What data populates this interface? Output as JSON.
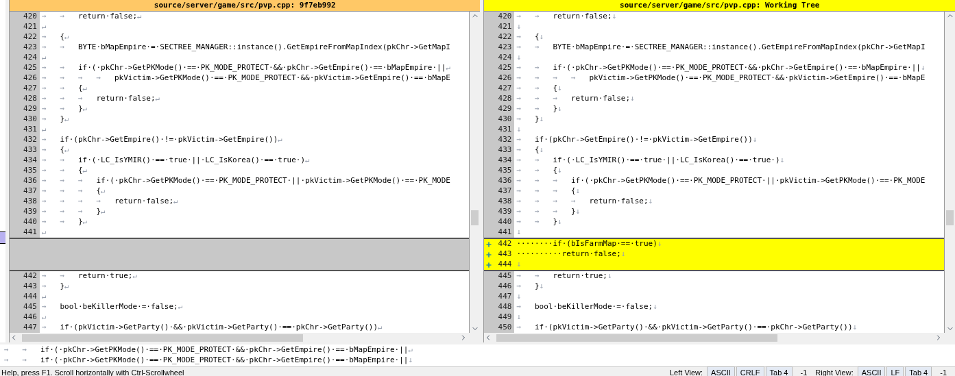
{
  "panes": [
    {
      "title": "source/server/game/src/pvp.cpp: 9f7eb992",
      "color": "#ffc866",
      "eol": "↵",
      "lines": [
        {
          "kind": "normal",
          "num": "420",
          "indent": [
            "→",
            "→"
          ],
          "code": "return·false;",
          "eol": true
        },
        {
          "kind": "normal",
          "num": "421",
          "eol": true
        },
        {
          "kind": "normal",
          "num": "422",
          "indent": [
            "→"
          ],
          "code": "{",
          "eol": true
        },
        {
          "kind": "normal",
          "num": "423",
          "indent": [
            "→",
            "→"
          ],
          "code": "BYTE·bMapEmpire·=·SECTREE_MANAGER::instance().GetEmpireFromMapIndex(pkChr->GetMapI",
          "eol": false
        },
        {
          "kind": "normal",
          "num": "424",
          "eol": true
        },
        {
          "kind": "normal",
          "num": "425",
          "indent": [
            "→",
            "→"
          ],
          "code": "if·(·pkChr->GetPKMode()·==·PK_MODE_PROTECT·&&·pkChr->GetEmpire()·==·bMapEmpire·||",
          "eol": true
        },
        {
          "kind": "normal",
          "num": "426",
          "indent": [
            "→",
            "→",
            "→",
            "→"
          ],
          "code": "pkVictim->GetPKMode()·==·PK_MODE_PROTECT·&&·pkVictim->GetEmpire()·==·bMapE",
          "eol": false
        },
        {
          "kind": "normal",
          "num": "427",
          "indent": [
            "→",
            "→"
          ],
          "code": "{",
          "eol": true
        },
        {
          "kind": "normal",
          "num": "428",
          "indent": [
            "→",
            "→",
            "→"
          ],
          "code": "return·false;",
          "eol": true
        },
        {
          "kind": "normal",
          "num": "429",
          "indent": [
            "→",
            "→"
          ],
          "code": "}",
          "eol": true
        },
        {
          "kind": "normal",
          "num": "430",
          "indent": [
            "→"
          ],
          "code": "}",
          "eol": true
        },
        {
          "kind": "normal",
          "num": "431",
          "eol": true
        },
        {
          "kind": "normal",
          "num": "432",
          "indent": [
            "→"
          ],
          "code": "if·(pkChr->GetEmpire()·!=·pkVictim->GetEmpire())",
          "eol": true
        },
        {
          "kind": "normal",
          "num": "433",
          "indent": [
            "→"
          ],
          "code": "{",
          "eol": true
        },
        {
          "kind": "normal",
          "num": "434",
          "indent": [
            "→",
            "→"
          ],
          "code": "if·(·LC_IsYMIR()·==·true·||·LC_IsKorea()·==·true·)",
          "eol": true
        },
        {
          "kind": "normal",
          "num": "435",
          "indent": [
            "→",
            "→"
          ],
          "code": "{",
          "eol": true
        },
        {
          "kind": "normal",
          "num": "436",
          "indent": [
            "→",
            "→",
            "→"
          ],
          "code": "if·(·pkChr->GetPKMode()·==·PK_MODE_PROTECT·||·pkVictim->GetPKMode()·==·PK_MODE",
          "eol": false
        },
        {
          "kind": "normal",
          "num": "437",
          "indent": [
            "→",
            "→",
            "→"
          ],
          "code": "{",
          "eol": true
        },
        {
          "kind": "normal",
          "num": "438",
          "indent": [
            "→",
            "→",
            "→",
            "→"
          ],
          "code": "return·false;",
          "eol": true
        },
        {
          "kind": "normal",
          "num": "439",
          "indent": [
            "→",
            "→",
            "→"
          ],
          "code": "}",
          "eol": true
        },
        {
          "kind": "normal",
          "num": "440",
          "indent": [
            "→",
            "→"
          ],
          "code": "}",
          "eol": true
        },
        {
          "kind": "normal",
          "num": "441",
          "eol": true
        },
        {
          "kind": "empty"
        },
        {
          "kind": "empty"
        },
        {
          "kind": "empty"
        },
        {
          "kind": "normal",
          "num": "442",
          "indent": [
            "→",
            "→"
          ],
          "code": "return·true;",
          "eol": true
        },
        {
          "kind": "normal",
          "num": "443",
          "indent": [
            "→"
          ],
          "code": "}",
          "eol": true
        },
        {
          "kind": "normal",
          "num": "444",
          "eol": true
        },
        {
          "kind": "normal",
          "num": "445",
          "indent": [
            "→"
          ],
          "code": "bool·beKillerMode·=·false;",
          "eol": true
        },
        {
          "kind": "normal",
          "num": "446",
          "eol": true
        },
        {
          "kind": "normal",
          "num": "447",
          "indent": [
            "→"
          ],
          "code": "if·(pkVictim->GetParty()·&&·pkVictim->GetParty()·==·pkChr->GetParty())",
          "eol": true
        }
      ]
    },
    {
      "title": "source/server/game/src/pvp.cpp: Working Tree",
      "color": "#ffff00",
      "eol": "↓",
      "lines": [
        {
          "kind": "normal",
          "num": "420",
          "indent": [
            "→",
            "→"
          ],
          "code": "return·false;",
          "eol": true
        },
        {
          "kind": "normal",
          "num": "421",
          "eol": true
        },
        {
          "kind": "normal",
          "num": "422",
          "indent": [
            "→"
          ],
          "code": "{",
          "eol": true
        },
        {
          "kind": "normal",
          "num": "423",
          "indent": [
            "→",
            "→"
          ],
          "code": "BYTE·bMapEmpire·=·SECTREE_MANAGER::instance().GetEmpireFromMapIndex(pkChr->GetMapI",
          "eol": false
        },
        {
          "kind": "normal",
          "num": "424",
          "eol": true
        },
        {
          "kind": "normal",
          "num": "425",
          "indent": [
            "→",
            "→"
          ],
          "code": "if·(·pkChr->GetPKMode()·==·PK_MODE_PROTECT·&&·pkChr->GetEmpire()·==·bMapEmpire·||",
          "eol": true
        },
        {
          "kind": "normal",
          "num": "426",
          "indent": [
            "→",
            "→",
            "→",
            "→"
          ],
          "code": "pkVictim->GetPKMode()·==·PK_MODE_PROTECT·&&·pkVictim->GetEmpire()·==·bMapE",
          "eol": false
        },
        {
          "kind": "normal",
          "num": "427",
          "indent": [
            "→",
            "→"
          ],
          "code": "{",
          "eol": true
        },
        {
          "kind": "normal",
          "num": "428",
          "indent": [
            "→",
            "→",
            "→"
          ],
          "code": "return·false;",
          "eol": true
        },
        {
          "kind": "normal",
          "num": "429",
          "indent": [
            "→",
            "→"
          ],
          "code": "}",
          "eol": true
        },
        {
          "kind": "normal",
          "num": "430",
          "indent": [
            "→"
          ],
          "code": "}",
          "eol": true
        },
        {
          "kind": "normal",
          "num": "431",
          "eol": true
        },
        {
          "kind": "normal",
          "num": "432",
          "indent": [
            "→"
          ],
          "code": "if·(pkChr->GetEmpire()·!=·pkVictim->GetEmpire())",
          "eol": true
        },
        {
          "kind": "normal",
          "num": "433",
          "indent": [
            "→"
          ],
          "code": "{",
          "eol": true
        },
        {
          "kind": "normal",
          "num": "434",
          "indent": [
            "→",
            "→"
          ],
          "code": "if·(·LC_IsYMIR()·==·true·||·LC_IsKorea()·==·true·)",
          "eol": true
        },
        {
          "kind": "normal",
          "num": "435",
          "indent": [
            "→",
            "→"
          ],
          "code": "{",
          "eol": true
        },
        {
          "kind": "normal",
          "num": "436",
          "indent": [
            "→",
            "→",
            "→"
          ],
          "code": "if·(·pkChr->GetPKMode()·==·PK_MODE_PROTECT·||·pkVictim->GetPKMode()·==·PK_MODE",
          "eol": false
        },
        {
          "kind": "normal",
          "num": "437",
          "indent": [
            "→",
            "→",
            "→"
          ],
          "code": "{",
          "eol": true
        },
        {
          "kind": "normal",
          "num": "438",
          "indent": [
            "→",
            "→",
            "→",
            "→"
          ],
          "code": "return·false;",
          "eol": true
        },
        {
          "kind": "normal",
          "num": "439",
          "indent": [
            "→",
            "→",
            "→"
          ],
          "code": "}",
          "eol": true
        },
        {
          "kind": "normal",
          "num": "440",
          "indent": [
            "→",
            "→"
          ],
          "code": "}",
          "eol": true
        },
        {
          "kind": "normal",
          "num": "441",
          "eol": true
        },
        {
          "kind": "added",
          "num": "442",
          "code": "········if·(bIsFarmMap·==·true)",
          "eol": true
        },
        {
          "kind": "added",
          "num": "443",
          "code": "··········return·false;",
          "eol": true
        },
        {
          "kind": "added",
          "num": "444",
          "eol": true
        },
        {
          "kind": "normal",
          "num": "445",
          "indent": [
            "→",
            "→"
          ],
          "code": "return·true;",
          "eol": true
        },
        {
          "kind": "normal",
          "num": "446",
          "indent": [
            "→"
          ],
          "code": "}",
          "eol": true
        },
        {
          "kind": "normal",
          "num": "447",
          "eol": true
        },
        {
          "kind": "normal",
          "num": "448",
          "indent": [
            "→"
          ],
          "code": "bool·beKillerMode·=·false;",
          "eol": true
        },
        {
          "kind": "normal",
          "num": "449",
          "eol": true
        },
        {
          "kind": "normal",
          "num": "450",
          "indent": [
            "→"
          ],
          "code": "if·(pkVictim->GetParty()·&&·pkVictim->GetParty()·==·pkChr->GetParty())",
          "eol": true
        }
      ]
    }
  ],
  "line_view": [
    {
      "indent": [
        "→",
        "→"
      ],
      "code": "if·(·pkChr->GetPKMode()·==·PK_MODE_PROTECT·&&·pkChr->GetEmpire()·==·bMapEmpire·||",
      "eol": "↵"
    },
    {
      "indent": [
        "→",
        "→"
      ],
      "code": "if·(·pkChr->GetPKMode()·==·PK_MODE_PROTECT·&&·pkChr->GetEmpire()·==·bMapEmpire·||",
      "eol": "↓"
    }
  ],
  "status_bar": {
    "help": "Help, press F1. Scroll horizontally with Ctrl-Scrollwheel",
    "views": [
      {
        "label": "Left View:",
        "fields": [
          "ASCII",
          "CRLF",
          "Tab 4"
        ],
        "line": "-1"
      },
      {
        "label": "Right View:",
        "fields": [
          "ASCII",
          "LF",
          "Tab 4"
        ],
        "line": "-1"
      }
    ]
  }
}
